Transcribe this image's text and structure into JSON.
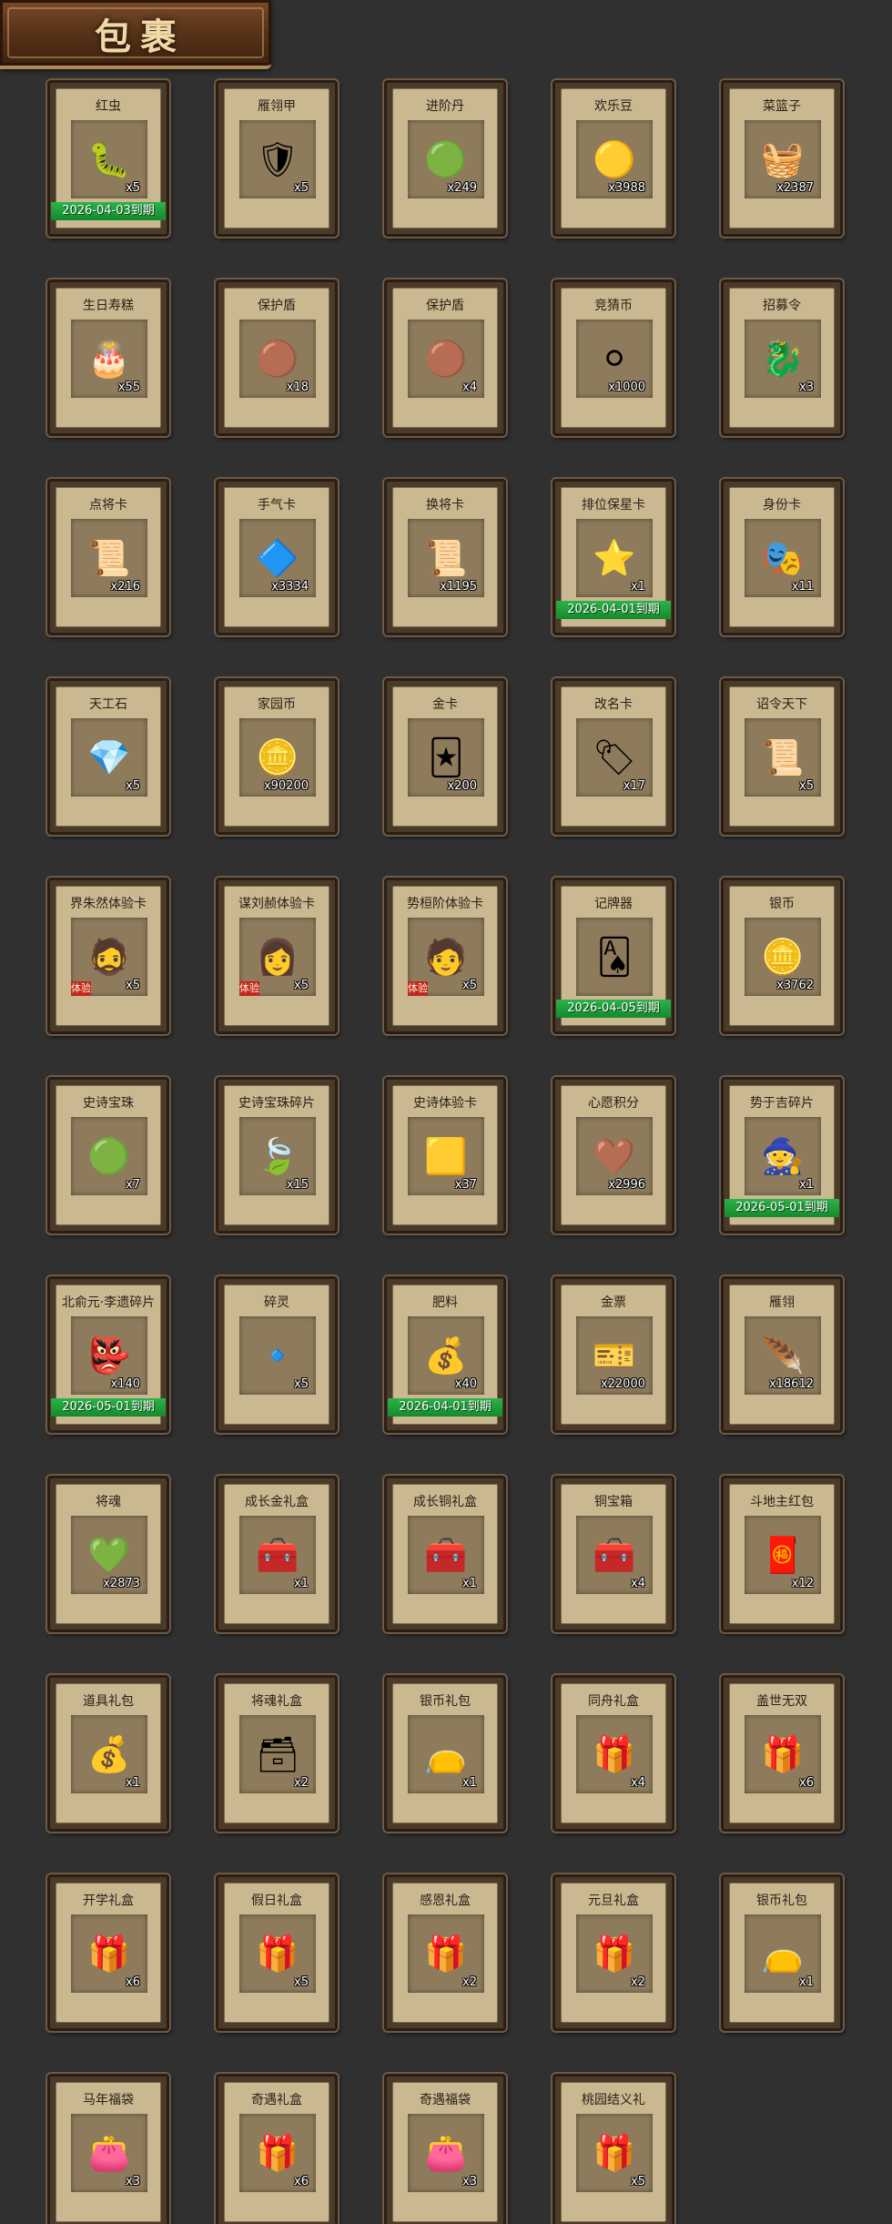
{
  "title": "包裹",
  "items": [
    {
      "name": "红虫",
      "count": "x5",
      "icon": "worm-icon",
      "glyph": "🐛",
      "expire": "2026-04-03到期"
    },
    {
      "name": "雁翎甲",
      "count": "x5",
      "icon": "armor-icon",
      "glyph": "🛡"
    },
    {
      "name": "进阶丹",
      "count": "x249",
      "icon": "pill-icon",
      "glyph": "🟢"
    },
    {
      "name": "欢乐豆",
      "count": "x3988",
      "icon": "beans-icon",
      "glyph": "🟡"
    },
    {
      "name": "菜篮子",
      "count": "x2387",
      "icon": "basket-icon",
      "glyph": "🧺"
    },
    {
      "name": "生日寿糕",
      "count": "x55",
      "icon": "cake-icon",
      "glyph": "🎂"
    },
    {
      "name": "保护盾",
      "count": "x18",
      "icon": "shield-icon",
      "glyph": "🟤"
    },
    {
      "name": "保护盾",
      "count": "x4",
      "icon": "shield-icon",
      "glyph": "🟤"
    },
    {
      "name": "竞猜币",
      "count": "x1000",
      "icon": "coin-icon",
      "glyph": "⚪"
    },
    {
      "name": "招募令",
      "count": "x3",
      "icon": "recruit-token-icon",
      "glyph": "🐉"
    },
    {
      "name": "点将卡",
      "count": "x216",
      "icon": "general-card-icon",
      "glyph": "📜"
    },
    {
      "name": "手气卡",
      "count": "x3334",
      "icon": "luck-card-icon",
      "glyph": "🔷"
    },
    {
      "name": "换将卡",
      "count": "x1195",
      "icon": "swap-card-icon",
      "glyph": "📜"
    },
    {
      "name": "排位保星卡",
      "count": "x1",
      "icon": "rank-card-icon",
      "glyph": "⭐",
      "expire": "2026-04-01到期"
    },
    {
      "name": "身份卡",
      "count": "x11",
      "icon": "identity-card-icon",
      "glyph": "🎭"
    },
    {
      "name": "天工石",
      "count": "x5",
      "icon": "crystal-icon",
      "glyph": "💎"
    },
    {
      "name": "家园币",
      "count": "x90200",
      "icon": "home-coin-icon",
      "glyph": "🪙"
    },
    {
      "name": "金卡",
      "count": "x200",
      "icon": "gold-card-icon",
      "glyph": "🃏"
    },
    {
      "name": "改名卡",
      "count": "x17",
      "icon": "rename-card-icon",
      "glyph": "🏷"
    },
    {
      "name": "诏令天下",
      "count": "x5",
      "icon": "scroll-icon",
      "glyph": "📜"
    },
    {
      "name": "界朱然体验卡",
      "count": "x5",
      "icon": "hero-portrait-icon",
      "glyph": "🧔",
      "hero_tag": "体验"
    },
    {
      "name": "谋刘赪体验卡",
      "count": "x5",
      "icon": "hero-portrait-icon",
      "glyph": "👩",
      "hero_tag": "体验"
    },
    {
      "name": "势桓阶体验卡",
      "count": "x5",
      "icon": "hero-portrait-icon",
      "glyph": "🧑",
      "hero_tag": "体验"
    },
    {
      "name": "记牌器",
      "count": "",
      "icon": "cards-icon",
      "glyph": "🂡",
      "expire": "2026-04-05到期"
    },
    {
      "name": "银币",
      "count": "x3762",
      "icon": "silver-coin-icon",
      "glyph": "🪙"
    },
    {
      "name": "史诗宝珠",
      "count": "x7",
      "icon": "orb-icon",
      "glyph": "🟢"
    },
    {
      "name": "史诗宝珠碎片",
      "count": "x15",
      "icon": "orb-fragment-icon",
      "glyph": "🍃"
    },
    {
      "name": "史诗体验卡",
      "count": "x37",
      "icon": "epic-card-icon",
      "glyph": "🟨"
    },
    {
      "name": "心愿积分",
      "count": "x2996",
      "icon": "wish-coin-icon",
      "glyph": "🤎"
    },
    {
      "name": "势于吉碎片",
      "count": "x1",
      "icon": "hero-fragment-icon",
      "glyph": "🧙",
      "expire": "2026-05-01到期"
    },
    {
      "name": "北俞元·李遗碎片",
      "count": "x140",
      "icon": "hero-portrait-icon",
      "glyph": "👺",
      "expire": "2026-05-01到期"
    },
    {
      "name": "碎灵",
      "count": "x5",
      "icon": "soul-shard-icon",
      "glyph": "🔹"
    },
    {
      "name": "肥料",
      "count": "x40",
      "icon": "fertilizer-icon",
      "glyph": "💰",
      "expire": "2026-04-01到期"
    },
    {
      "name": "金票",
      "count": "x22000",
      "icon": "gold-ticket-icon",
      "glyph": "🎫"
    },
    {
      "name": "雁翎",
      "count": "x18612",
      "icon": "feather-icon",
      "glyph": "🪶"
    },
    {
      "name": "将魂",
      "count": "x2873",
      "icon": "soul-icon",
      "glyph": "💚"
    },
    {
      "name": "成长金礼盒",
      "count": "x1",
      "icon": "gold-chest-icon",
      "glyph": "🧰"
    },
    {
      "name": "成长铜礼盒",
      "count": "x1",
      "icon": "bronze-chest-icon",
      "glyph": "🧰"
    },
    {
      "name": "铜宝箱",
      "count": "x4",
      "icon": "bronze-chest-icon",
      "glyph": "🧰"
    },
    {
      "name": "斗地主红包",
      "count": "x12",
      "icon": "red-envelope-icon",
      "glyph": "🧧"
    },
    {
      "name": "道具礼包",
      "count": "x1",
      "icon": "gold-bag-icon",
      "glyph": "💰"
    },
    {
      "name": "将魂礼盒",
      "count": "x2",
      "icon": "blue-box-icon",
      "glyph": "🗃"
    },
    {
      "name": "银币礼包",
      "count": "x1",
      "icon": "blue-bag-icon",
      "glyph": "👝"
    },
    {
      "name": "同舟礼盒",
      "count": "x4",
      "icon": "gift-box-icon",
      "glyph": "🎁"
    },
    {
      "name": "盖世无双",
      "count": "x6",
      "icon": "gift-box-icon",
      "glyph": "🎁"
    },
    {
      "name": "开学礼盒",
      "count": "x6",
      "icon": "gift-box-icon",
      "glyph": "🎁"
    },
    {
      "name": "假日礼盒",
      "count": "x5",
      "icon": "gift-box-icon",
      "glyph": "🎁"
    },
    {
      "name": "感恩礼盒",
      "count": "x2",
      "icon": "gift-box-icon",
      "glyph": "🎁"
    },
    {
      "name": "元旦礼盒",
      "count": "x2",
      "icon": "gift-box-icon",
      "glyph": "🎁"
    },
    {
      "name": "银币礼包",
      "count": "x1",
      "icon": "blue-bag-icon",
      "glyph": "👝"
    },
    {
      "name": "马年福袋",
      "count": "x3",
      "icon": "lucky-bag-icon",
      "glyph": "👛"
    },
    {
      "name": "奇遇礼盒",
      "count": "x6",
      "icon": "gift-box-icon",
      "glyph": "🎁"
    },
    {
      "name": "奇遇福袋",
      "count": "x3",
      "icon": "lucky-bag-icon",
      "glyph": "👛"
    },
    {
      "name": "桃园结义礼",
      "count": "x5",
      "icon": "gift-box-icon",
      "glyph": "🎁"
    }
  ]
}
